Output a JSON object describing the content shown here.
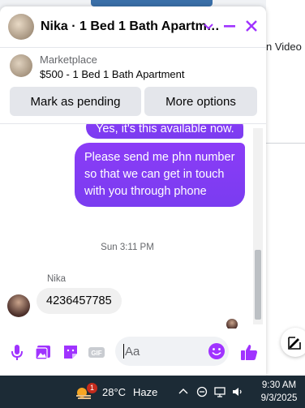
{
  "background": {
    "partial_text": "n Video"
  },
  "chat": {
    "title": "Nika · 1 Bed 1 Bath Apartm…",
    "listing": {
      "source": "Marketplace",
      "title": "$500 - 1 Bed 1 Bath Apartment"
    },
    "actions": {
      "mark_pending": "Mark as pending",
      "more_options": "More options"
    },
    "messages": {
      "outgoing_partial": "Yes, it's this available now.",
      "outgoing": "Please send me  phn number so that we can get in touch with you through phone",
      "timestamp": "Sun 3:11 PM",
      "sender": "Nika",
      "incoming": "4236457785"
    },
    "composer": {
      "placeholder": "Aa",
      "icons": [
        "microphone-icon",
        "photo-icon",
        "sticker-icon",
        "gif-icon",
        "emoji-icon",
        "like-icon"
      ]
    },
    "accent_color": "#a033ff",
    "bubble_color": "#7b3cf2"
  },
  "taskbar": {
    "weather_badge": "1",
    "temperature": "28°C",
    "condition": "Haze",
    "time": "9:30 AM",
    "date": "9/3/2025"
  }
}
